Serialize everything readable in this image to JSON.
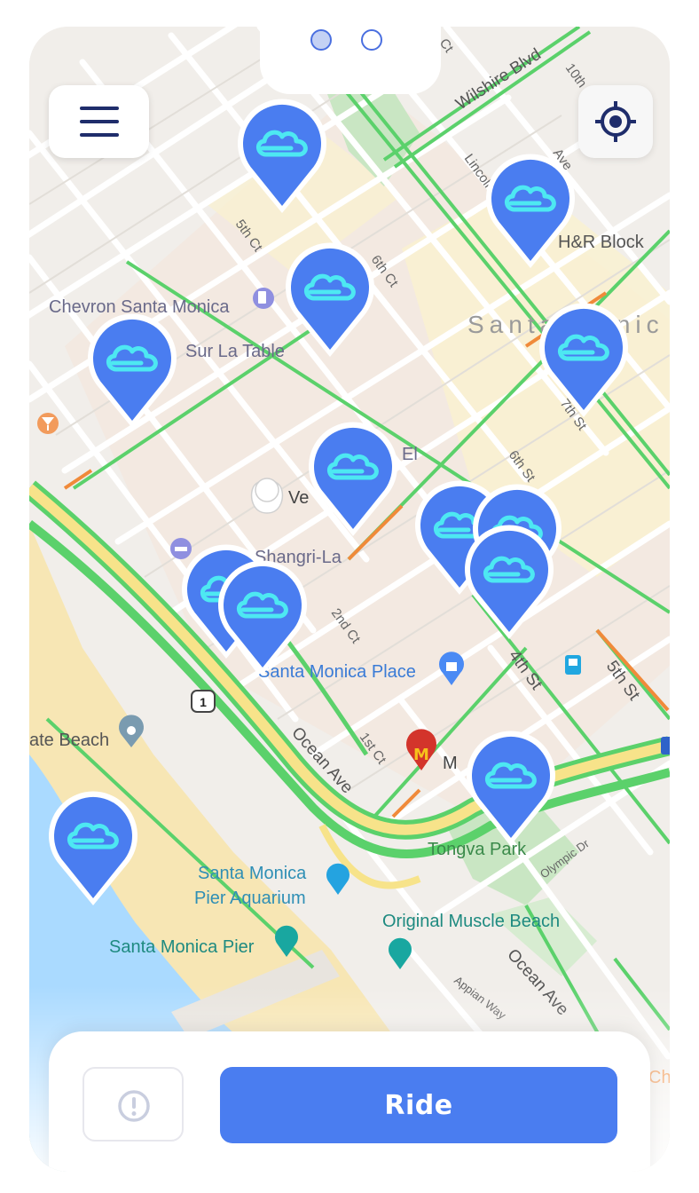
{
  "pager": {
    "dots": [
      "page-1",
      "page-2"
    ],
    "active_index": 0
  },
  "header": {
    "menu_icon": "hamburger-menu-icon",
    "locate_icon": "locate-crosshair-icon"
  },
  "map": {
    "streets": [
      "Wilshire Blvd",
      "Lincoln",
      "Ave",
      "10th Ct",
      "Ct",
      "5th Ct",
      "6th Ct",
      "7th St",
      "6th St",
      "2nd Ct",
      "4th St",
      "5th St",
      "1st Ct",
      "Ocean Ave",
      "Ocean Ave",
      "Olympic Dr",
      "Appian Way"
    ],
    "places": {
      "hr_block": "H&R Block",
      "chevron": "Chevron Santa Monica",
      "santa_monica": "Santa Monic",
      "sur_la_table": "Sur La Table",
      "verizon": "Ve",
      "el": "El",
      "shangri_la": "Shangri-La",
      "santa_monica_place": "Santa Monica Place",
      "state_beach": "ate Beach",
      "mcdonalds": "M",
      "tongva_park": "Tongva Park",
      "aquarium_line1": "Santa Monica",
      "aquarium_line2": "Pier Aquarium",
      "muscle_beach": "Original Muscle Beach",
      "pier": "Santa Monica Pier",
      "ch": "Ch"
    },
    "route_shield": "1",
    "marker_icon": "cloud-scooter-icon",
    "marker_count": 13
  },
  "actions": {
    "alert_icon": "alert-exclamation-icon",
    "ride_label": "Ride"
  },
  "colors": {
    "accent": "#4A7DF0",
    "marker": "#4A7DF0",
    "marker_cloud": "#4DE8F2",
    "traffic_green": "#5BD16B",
    "traffic_orange": "#F08A3A",
    "water": "#AADAFF",
    "sand": "#F7E6B4"
  }
}
